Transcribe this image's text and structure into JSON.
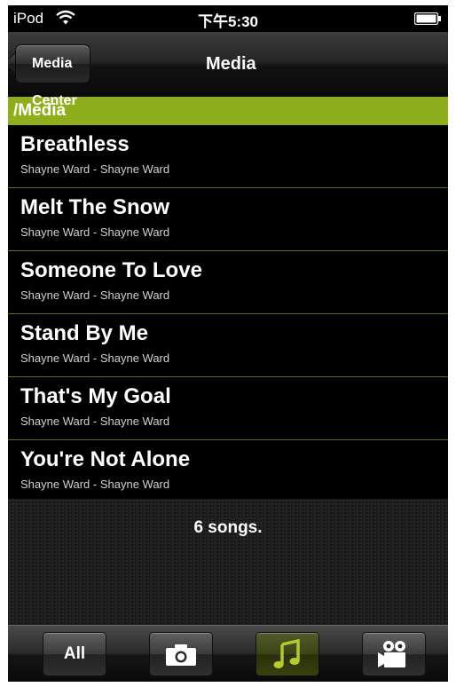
{
  "status_bar": {
    "carrier": "iPod",
    "time": "下午5:30"
  },
  "nav": {
    "back_label": "Media Center",
    "title": "Media"
  },
  "path_header": "/Media",
  "songs": [
    {
      "title": "Breathless",
      "subtitle": "Shayne Ward - Shayne Ward"
    },
    {
      "title": "Melt The Snow",
      "subtitle": "Shayne Ward - Shayne Ward"
    },
    {
      "title": "Someone To Love",
      "subtitle": "Shayne Ward - Shayne Ward"
    },
    {
      "title": "Stand By Me",
      "subtitle": "Shayne Ward - Shayne Ward"
    },
    {
      "title": "That's My Goal",
      "subtitle": "Shayne Ward - Shayne Ward"
    },
    {
      "title": "You're Not Alone",
      "subtitle": "Shayne Ward - Shayne Ward"
    }
  ],
  "song_count": "6 songs.",
  "tabs": [
    {
      "label": "All",
      "icon": "text",
      "active": false
    },
    {
      "label": "",
      "icon": "camera-icon",
      "active": false
    },
    {
      "label": "",
      "icon": "music-note-icon",
      "active": true
    },
    {
      "label": "",
      "icon": "video-camera-icon",
      "active": false
    }
  ],
  "colors": {
    "accent_green": "#8fae1b",
    "music_icon": "#b7cc2c"
  }
}
